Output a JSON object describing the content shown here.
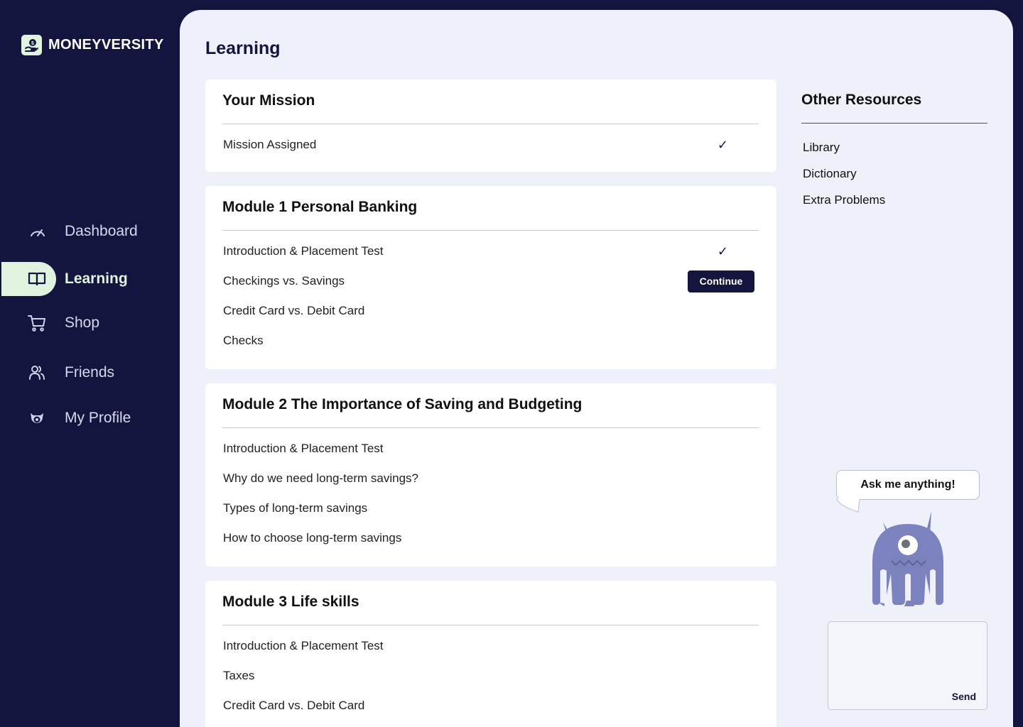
{
  "brand": {
    "name": "MONEYVERSITY"
  },
  "nav": {
    "items": [
      {
        "label": "Dashboard",
        "icon": "gauge-icon"
      },
      {
        "label": "Learning",
        "icon": "book-icon"
      },
      {
        "label": "Shop",
        "icon": "cart-icon"
      },
      {
        "label": "Friends",
        "icon": "users-icon"
      },
      {
        "label": "My Profile",
        "icon": "profile-icon"
      }
    ],
    "active": "Learning"
  },
  "page": {
    "title": "Learning"
  },
  "mission": {
    "title": "Your Mission",
    "items": [
      {
        "label": "Mission Assigned",
        "status": "done",
        "check": "✓"
      }
    ]
  },
  "modules": [
    {
      "title": "Module 1 Personal Banking",
      "lessons": [
        {
          "label": "Introduction & Placement Test",
          "status": "done",
          "check": "✓"
        },
        {
          "label": "Checkings vs. Savings",
          "status": "current",
          "action": "Continue"
        },
        {
          "label": "Credit Card vs. Debit Card",
          "status": "locked"
        },
        {
          "label": "Checks",
          "status": "locked"
        }
      ]
    },
    {
      "title": "Module 2 The Importance of Saving and Budgeting",
      "lessons": [
        {
          "label": "Introduction & Placement Test"
        },
        {
          "label": "Why do we need long-term savings?"
        },
        {
          "label": "Types of long-term savings"
        },
        {
          "label": "How to choose long-term savings"
        }
      ]
    },
    {
      "title": "Module 3 Life skills",
      "lessons": [
        {
          "label": "Introduction & Placement Test"
        },
        {
          "label": "Taxes"
        },
        {
          "label": "Credit Card vs. Debit Card"
        }
      ]
    }
  ],
  "resources": {
    "title": "Other Resources",
    "links": [
      "Library",
      "Dictionary",
      "Extra Problems"
    ]
  },
  "chat": {
    "bubble": "Ask me anything!",
    "input_value": "",
    "send_label": "Send"
  },
  "colors": {
    "navy": "#13153f",
    "panel": "#eef0fa",
    "mint": "#dff3df",
    "mascot": "#7c82bd"
  }
}
